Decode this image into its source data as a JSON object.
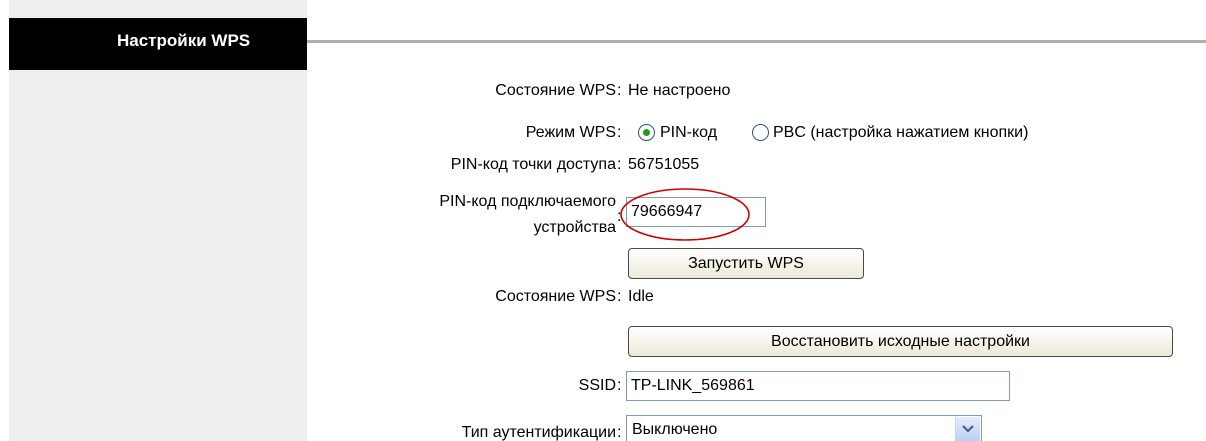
{
  "header": {
    "title": "Настройки WPS"
  },
  "form": {
    "wps_status_label": "Состояние WPS",
    "wps_status_value": "Не настроено",
    "wps_mode_label": "Режим WPS",
    "mode_options": {
      "pin": "PIN-код",
      "pbc": "PBC (настройка нажатием кнопки)"
    },
    "mode_selected": "pin",
    "ap_pin_label": "PIN-код точки доступа",
    "ap_pin_value": "56751055",
    "client_pin_label_line1": "PIN-код подключаемого",
    "client_pin_label_line2": "устройства",
    "client_pin_value": "79666947",
    "start_wps_button": "Запустить WPS",
    "wps_state_label": "Состояние WPS",
    "wps_state_value": "Idle",
    "restore_defaults_button": "Восстановить исходные настройки",
    "ssid_label": "SSID",
    "ssid_value": "TP-LINK_569861",
    "auth_type_label": "Тип аутентификации",
    "auth_type_value": "Выключено",
    "separator": ":"
  },
  "colors": {
    "header_bg": "#000000",
    "header_text": "#ffffff",
    "sidebar_bg": "#efefef",
    "highlight": "#cc0000"
  }
}
